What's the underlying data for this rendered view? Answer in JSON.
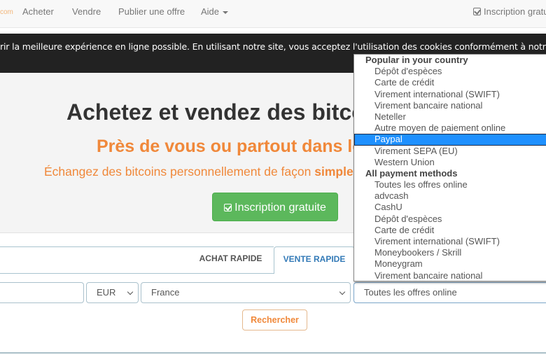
{
  "navbar": {
    "brand_fragment": "com",
    "items": [
      {
        "label": "Acheter"
      },
      {
        "label": "Vendre"
      },
      {
        "label": "Publier une offre"
      },
      {
        "label": "Aide"
      }
    ],
    "signup_label": "Inscription gratu"
  },
  "cookie_banner": {
    "text": "rir la meilleure expérience en ligne possible. En utilisant notre site, vous acceptez l'utilisation des cookies conformément à notre"
  },
  "hero": {
    "title": "Achetez et vendez des bitcoins",
    "subtitle": "Près de vous ou partout dans le monde",
    "description_prefix": "Échangez des bitcoins personnellement de façon ",
    "description_bold": "simple",
    "signup_button": "Inscription gratuite"
  },
  "tabs": [
    {
      "label": "ACHAT RAPIDE",
      "active": false
    },
    {
      "label": "VENTE RAPIDE",
      "active": true
    }
  ],
  "form": {
    "amount_value": "",
    "currency": "EUR",
    "country": "France",
    "payment_method": "Toutes les offres online",
    "search_button": "Rechercher"
  },
  "payment_dropdown": {
    "groups": [
      {
        "label": "Popular in your country",
        "options": [
          "Dépôt d'espèces",
          "Carte de crédit",
          "Virement international (SWIFT)",
          "Virement bancaire national",
          "Neteller",
          "Autre moyen de paiement online",
          "Paypal",
          "Virement SEPA (EU)",
          "Western Union"
        ]
      },
      {
        "label": "All payment methods",
        "options": [
          "Toutes les offres online",
          "advcash",
          "CashU",
          "Dépôt d'espèces",
          "Carte de crédit",
          "Virement international (SWIFT)",
          "Moneybookers / Skrill",
          "Moneygram",
          "Virement bancaire national"
        ]
      }
    ],
    "highlighted": "Paypal"
  },
  "colors": {
    "accent_orange": "#f0883a",
    "success_green": "#5cb85c",
    "link_blue": "#337ab7",
    "highlight_blue": "#1e90ff",
    "cookie_bg": "#222222"
  }
}
